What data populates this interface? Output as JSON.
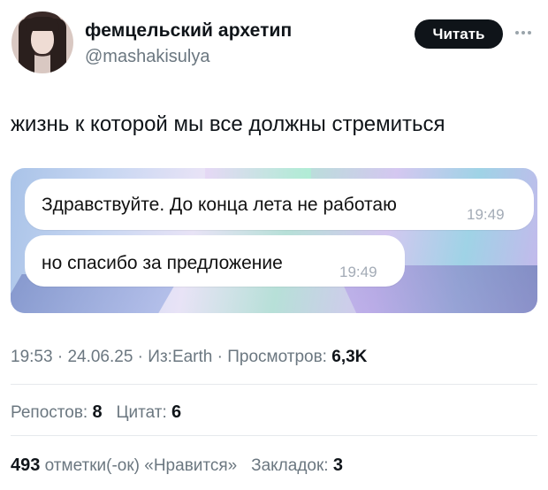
{
  "author": {
    "display_name": "фемцельский архетип",
    "handle": "@mashakisulya"
  },
  "actions": {
    "follow_label": "Читать",
    "more_icon": "more-horizontal-icon"
  },
  "tweet": {
    "text": "жизнь к которой мы все должны стремиться"
  },
  "media": {
    "messages": [
      {
        "text": "Здравствуйте. До конца лета не работаю",
        "time": "19:49"
      },
      {
        "text": "но спасибо за предложение",
        "time": "19:49"
      }
    ]
  },
  "meta": {
    "time": "19:53",
    "date": "24.06.25",
    "source": "Из:Earth",
    "views_label": "Просмотров:",
    "views_count": "6,3K",
    "sep": " · "
  },
  "stats": {
    "reposts_label": "Репостов:",
    "reposts_count": "8",
    "quotes_label": "Цитат:",
    "quotes_count": "6",
    "likes_count": "493",
    "likes_label": "отметки(-ок) «Нравится»",
    "bookmarks_label": "Закладок:",
    "bookmarks_count": "3"
  },
  "colors": {
    "text_primary": "#0f1419",
    "text_secondary": "#6b7780",
    "button_bg": "#0f1419",
    "divider": "#e6e9ec"
  }
}
